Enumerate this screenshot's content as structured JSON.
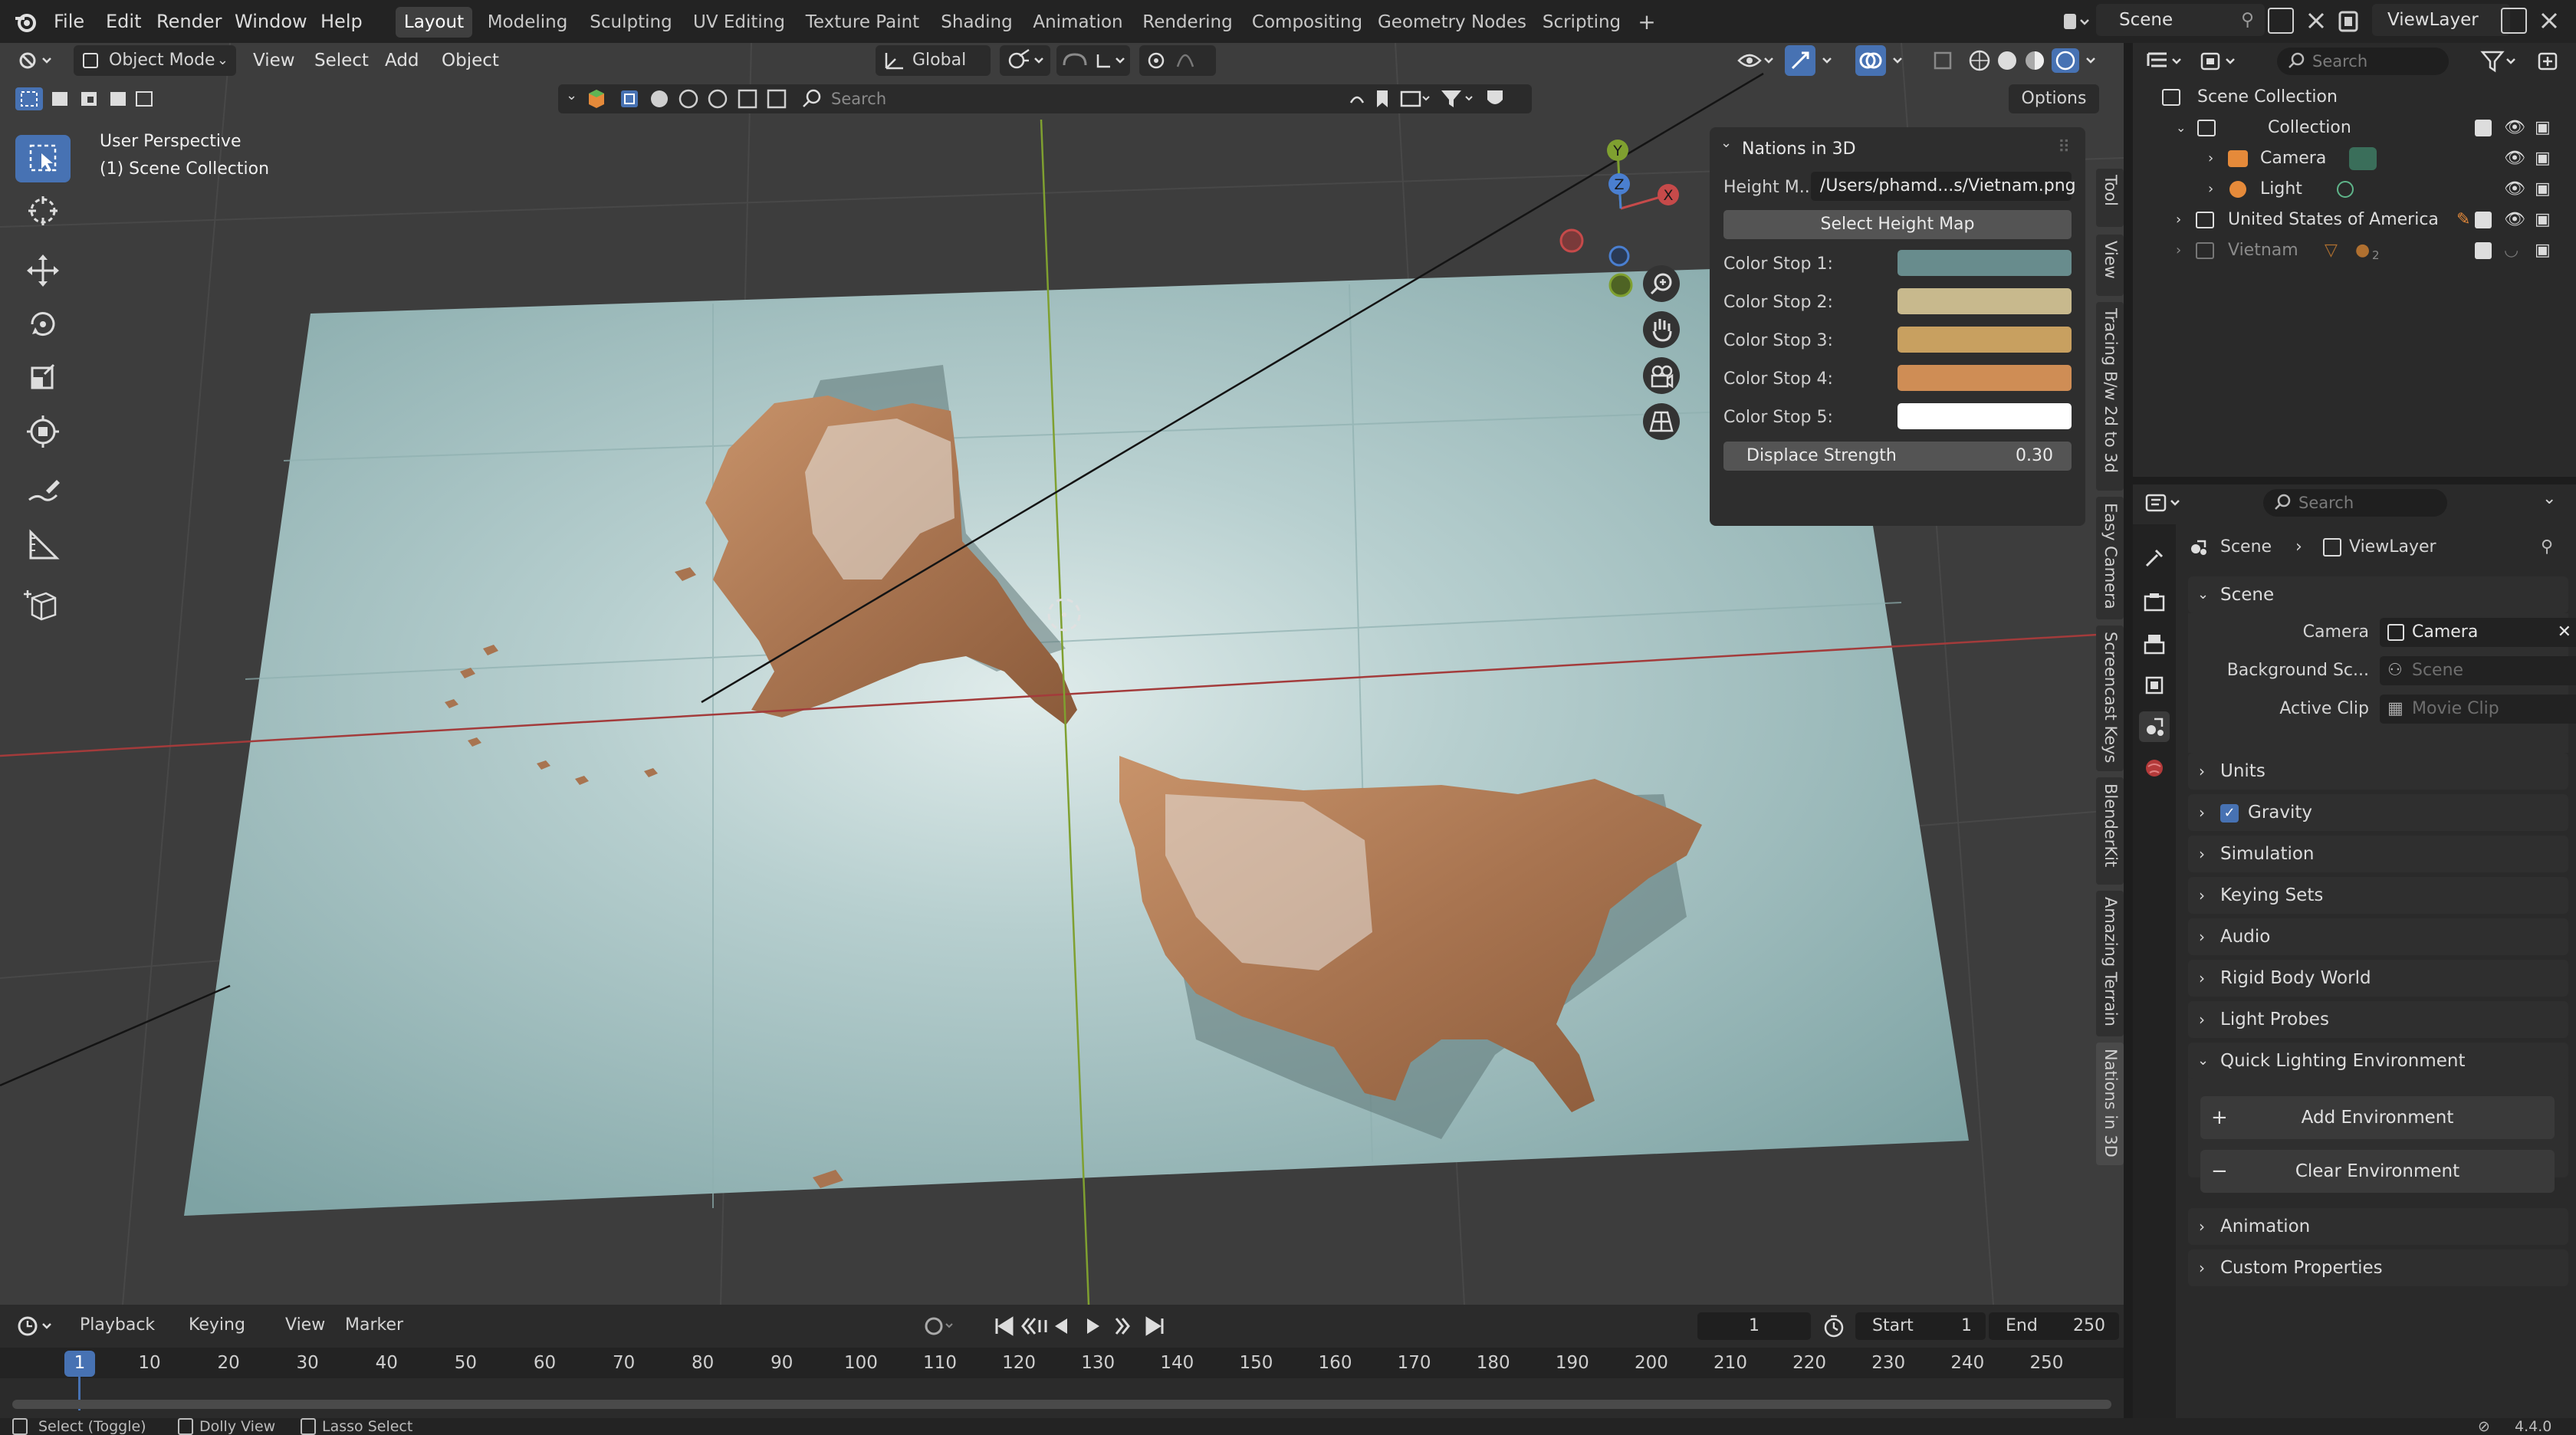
{
  "topbar": {
    "menus": [
      "File",
      "Edit",
      "Render",
      "Window",
      "Help"
    ],
    "workspaces": [
      "Layout",
      "Modeling",
      "Sculpting",
      "UV Editing",
      "Texture Paint",
      "Shading",
      "Animation",
      "Rendering",
      "Compositing",
      "Geometry Nodes",
      "Scripting"
    ],
    "active_workspace": "Layout",
    "scene": "Scene",
    "view_layer": "ViewLayer"
  },
  "viewport": {
    "mode": "Object Mode",
    "menus": [
      "View",
      "Select",
      "Add",
      "Object"
    ],
    "orientation": "Global",
    "search_placeholder": "Search",
    "options_label": "Options",
    "overlay_title": "User Perspective",
    "overlay_collection": "(1) Scene Collection",
    "gizmo_axes": {
      "x": "X",
      "y": "Y",
      "z": "Z"
    }
  },
  "nations_panel": {
    "title": "Nations in 3D",
    "height_map_label": "Height M...",
    "height_map_value": "/Users/phamd...s/Vietnam.png",
    "select_button": "Select Height Map",
    "color_stops": [
      {
        "label": "Color Stop 1:",
        "color": "#688c8d"
      },
      {
        "label": "Color Stop 2:",
        "color": "#c8b98d"
      },
      {
        "label": "Color Stop 3:",
        "color": "#c8a060"
      },
      {
        "label": "Color Stop 4:",
        "color": "#cf8d55"
      },
      {
        "label": "Color Stop 5:",
        "color": "#ffffff"
      }
    ],
    "displace_label": "Displace Strength",
    "displace_value": "0.30"
  },
  "side_tabs": [
    "Tool",
    "View",
    "Tracing B/w 2d to 3d",
    "Easy Camera",
    "Screencast Keys",
    "BlenderKit",
    "Amazing Terrain",
    "Nations in 3D"
  ],
  "timeline": {
    "menus": [
      "Playback",
      "Keying",
      "View",
      "Marker"
    ],
    "current_frame": "1",
    "start_label": "Start",
    "start_value": "1",
    "end_label": "End",
    "end_value": "250",
    "ruler": [
      "1",
      "10",
      "20",
      "30",
      "40",
      "50",
      "60",
      "70",
      "80",
      "90",
      "100",
      "110",
      "120",
      "130",
      "140",
      "150",
      "160",
      "170",
      "180",
      "190",
      "200",
      "210",
      "220",
      "230",
      "240",
      "250"
    ]
  },
  "statusbar": {
    "hints": [
      "Select (Toggle)",
      "Dolly View",
      "Lasso Select"
    ],
    "version": "4.4.0"
  },
  "outliner": {
    "search_placeholder": "Search",
    "root": "Scene Collection",
    "items": [
      {
        "label": "Collection",
        "indent": 1
      },
      {
        "label": "Camera",
        "indent": 2
      },
      {
        "label": "Light",
        "indent": 2
      },
      {
        "label": "United States of America",
        "indent": 1
      },
      {
        "label": "Vietnam",
        "indent": 1,
        "badge": "2"
      }
    ]
  },
  "properties": {
    "search_placeholder": "Search",
    "breadcrumb": [
      "Scene",
      "ViewLayer"
    ],
    "scene_section": "Scene",
    "fields": [
      {
        "label": "Camera",
        "value": "Camera"
      },
      {
        "label": "Background Sc...",
        "value": "Scene"
      },
      {
        "label": "Active Clip",
        "value": "Movie Clip"
      }
    ],
    "panels": [
      "Units",
      "Gravity",
      "Simulation",
      "Keying Sets",
      "Audio",
      "Rigid Body World",
      "Light Probes",
      "Quick Lighting Environment"
    ],
    "add_env": "Add Environment",
    "clear_env": "Clear Environment",
    "panels_after": [
      "Animation",
      "Custom Properties"
    ]
  }
}
